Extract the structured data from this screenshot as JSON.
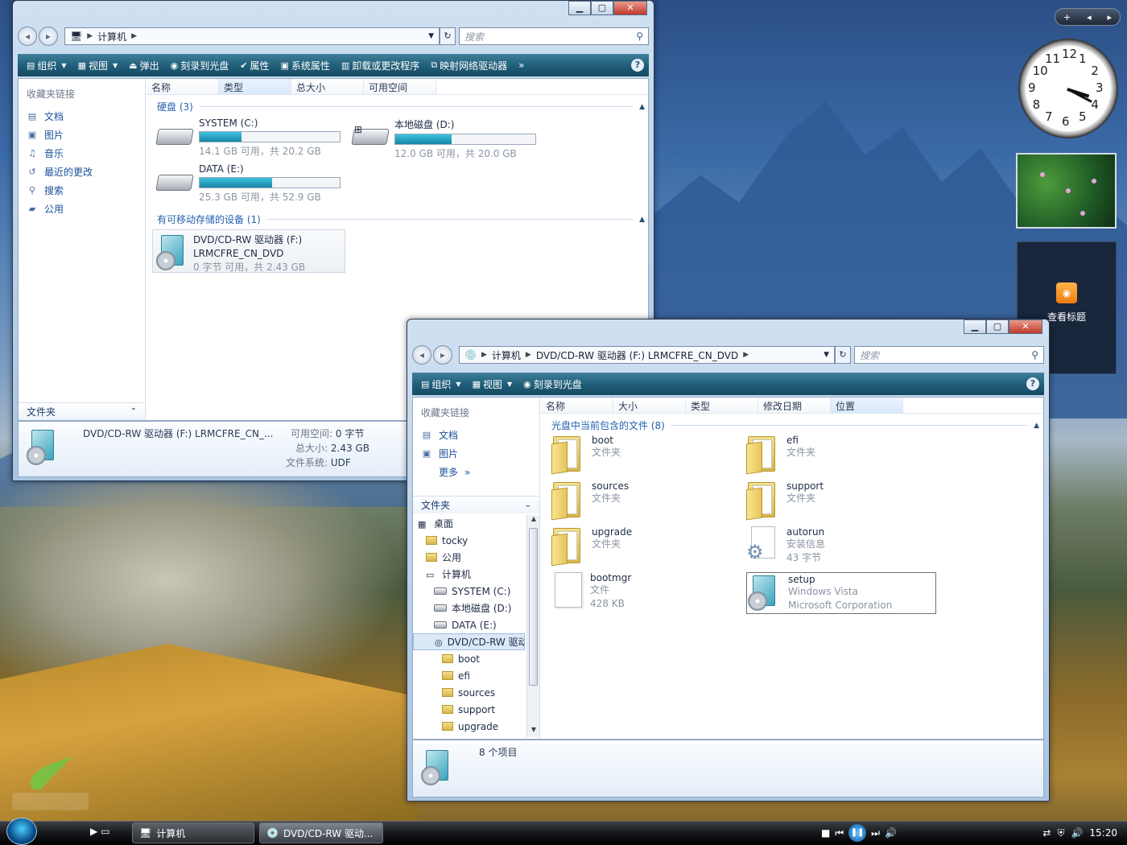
{
  "win1": {
    "address": [
      "计算机"
    ],
    "search_placeholder": "搜索",
    "toolbar": [
      {
        "icon": "organize-icon",
        "label": "组织",
        "menu": true
      },
      {
        "icon": "views-icon",
        "label": "视图",
        "menu": true
      },
      {
        "icon": "eject-icon",
        "label": "弹出"
      },
      {
        "icon": "burn-icon",
        "label": "刻录到光盘"
      },
      {
        "icon": "checkmark-icon",
        "label": "属性"
      },
      {
        "icon": "system-properties-icon",
        "label": "系统属性"
      },
      {
        "icon": "uninstall-icon",
        "label": "卸载或更改程序"
      },
      {
        "icon": "map-drive-icon",
        "label": "映射网络驱动器"
      }
    ],
    "more": "»",
    "nav_title": "收藏夹链接",
    "nav_links": [
      "文档",
      "图片",
      "音乐",
      "最近的更改",
      "搜索",
      "公用"
    ],
    "folders_label": "文件夹",
    "columns": [
      "名称",
      "类型",
      "总大小",
      "可用空间"
    ],
    "group_hdd": "硬盘 (3)",
    "drives": [
      {
        "name": "SYSTEM (C:)",
        "free": "14.1 GB 可用，共 20.2 GB",
        "used_pct": 30
      },
      {
        "name": "本地磁盘 (D:)",
        "free": "12.0 GB 可用，共 20.0 GB",
        "used_pct": 40
      },
      {
        "name": "DATA (E:)",
        "free": "25.3 GB 可用，共 52.9 GB",
        "used_pct": 52
      }
    ],
    "group_removable": "有可移动存储的设备 (1)",
    "dvd": {
      "name": "DVD/CD-RW 驱动器 (F:)",
      "label": "LRMCFRE_CN_DVD",
      "free": "0 字节 可用，共 2.43 GB"
    },
    "details": {
      "title": "DVD/CD-RW 驱动器 (F:) LRMCFRE_CN_...",
      "free_k": "可用空间:",
      "free_v": "0 字节",
      "total_k": "总大小:",
      "total_v": "2.43 GB",
      "fs_k": "文件系统:",
      "fs_v": "UDF"
    }
  },
  "win2": {
    "address": [
      "计算机",
      "DVD/CD-RW 驱动器 (F:) LRMCFRE_CN_DVD"
    ],
    "search_placeholder": "搜索",
    "toolbar": [
      {
        "icon": "organize-icon",
        "label": "组织",
        "menu": true
      },
      {
        "icon": "views-icon",
        "label": "视图",
        "menu": true
      },
      {
        "icon": "burn-icon",
        "label": "刻录到光盘"
      }
    ],
    "nav_title": "收藏夹链接",
    "nav_links": [
      "文档",
      "图片",
      "更多"
    ],
    "folders_label": "文件夹",
    "tree": [
      {
        "label": "桌面",
        "level": 0,
        "icon": "desktop-icon"
      },
      {
        "label": "tocky",
        "level": 1,
        "icon": "user-folder-icon"
      },
      {
        "label": "公用",
        "level": 1,
        "icon": "folder-icon"
      },
      {
        "label": "计算机",
        "level": 1,
        "icon": "computer-icon"
      },
      {
        "label": "SYSTEM (C:)",
        "level": 2,
        "icon": "drive-icon"
      },
      {
        "label": "本地磁盘 (D:)",
        "level": 2,
        "icon": "drive-icon"
      },
      {
        "label": "DATA (E:)",
        "level": 2,
        "icon": "drive-icon"
      },
      {
        "label": "DVD/CD-RW 驱动",
        "level": 2,
        "icon": "dvd-icon",
        "selected": true
      },
      {
        "label": "boot",
        "level": 3,
        "icon": "folder-icon"
      },
      {
        "label": "efi",
        "level": 3,
        "icon": "folder-icon"
      },
      {
        "label": "sources",
        "level": 3,
        "icon": "folder-icon"
      },
      {
        "label": "support",
        "level": 3,
        "icon": "folder-icon"
      },
      {
        "label": "upgrade",
        "level": 3,
        "icon": "folder-icon"
      }
    ],
    "columns": [
      "名称",
      "大小",
      "类型",
      "修改日期",
      "位置"
    ],
    "group": "光盘中当前包含的文件 (8)",
    "files": [
      {
        "name": "boot",
        "l1": "文件夹",
        "l2": "",
        "kind": "folder"
      },
      {
        "name": "efi",
        "l1": "文件夹",
        "l2": "",
        "kind": "folder"
      },
      {
        "name": "sources",
        "l1": "文件夹",
        "l2": "",
        "kind": "folder"
      },
      {
        "name": "support",
        "l1": "文件夹",
        "l2": "",
        "kind": "folder"
      },
      {
        "name": "upgrade",
        "l1": "文件夹",
        "l2": "",
        "kind": "folder"
      },
      {
        "name": "autorun",
        "l1": "安装信息",
        "l2": "43 字节",
        "kind": "inf"
      },
      {
        "name": "bootmgr",
        "l1": "文件",
        "l2": "428 KB",
        "kind": "file"
      },
      {
        "name": "setup",
        "l1": "Windows Vista",
        "l2": "Microsoft Corporation",
        "kind": "setup"
      }
    ],
    "status": "8 个项目"
  },
  "gadgets": {
    "rss_label": "查看标题",
    "clock_numbers": [
      "12",
      "1",
      "2",
      "3",
      "4",
      "5",
      "6",
      "7",
      "8",
      "9",
      "10",
      "11"
    ]
  },
  "taskbar": {
    "tasks": [
      "计算机",
      "DVD/CD-RW 驱动..."
    ],
    "time": "15:20"
  }
}
